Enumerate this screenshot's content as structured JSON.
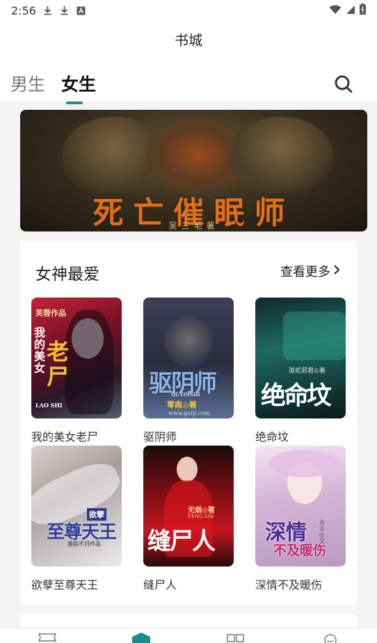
{
  "status_bar": {
    "time": "2:56",
    "icons": [
      "download-icon",
      "download-icon",
      "font-icon",
      "wifi-icon",
      "signal-icon",
      "battery-icon"
    ]
  },
  "header": {
    "title": "书城"
  },
  "tabs": {
    "items": [
      {
        "label": "男生",
        "active": false
      },
      {
        "label": "女生",
        "active": true
      }
    ],
    "accent_color": "#1f8a8e"
  },
  "banner": {
    "title": "死亡催眠师",
    "author": "吴三毛著",
    "slide_count": 1,
    "active_slide": 1
  },
  "section": {
    "title": "女神最爱",
    "see_more": "查看更多",
    "books": [
      {
        "name": "我的美女老尸",
        "cover": {
          "big": "老尸",
          "small": "我的美女",
          "tag": "LAO SHI",
          "author": "芙蓉作品"
        }
      },
      {
        "name": "驱阴师",
        "cover": {
          "big": "驱阴师",
          "tag": "QUYINSHI",
          "author": "零南◎著",
          "site": "www.guiji.com"
        }
      },
      {
        "name": "绝命坟",
        "cover": {
          "big": "绝命坟",
          "author": "驱蛇邪君◎著"
        }
      },
      {
        "name": "欲孽至尊天王",
        "cover": {
          "big": "至尊天王",
          "badge": "欲孽",
          "author": "墨韵不日作品"
        }
      },
      {
        "name": "缝尸人",
        "cover": {
          "big": "缝尸人",
          "tag": "FENG SHI",
          "author": "无烟◎著"
        }
      },
      {
        "name": "深情不及暖伤",
        "cover": {
          "big": "深情",
          "sub": "不及暖伤",
          "author": "云言◎文"
        }
      }
    ]
  },
  "bottom_nav": {
    "items": [
      "bookshelf-icon",
      "bookstore-icon",
      "category-icon",
      "profile-icon"
    ],
    "active_index": 1
  }
}
